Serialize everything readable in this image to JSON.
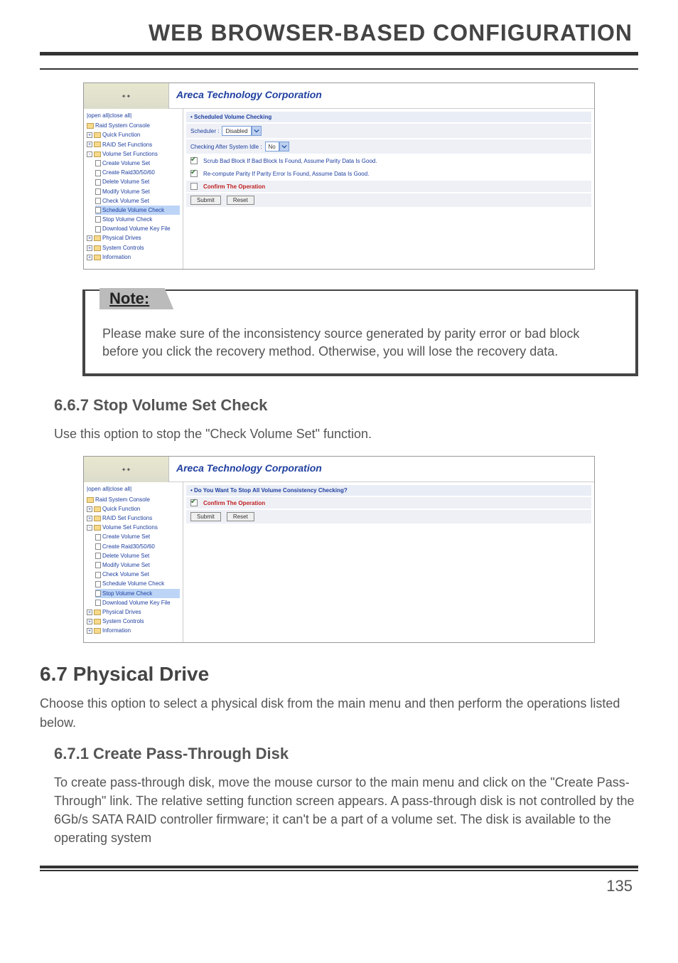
{
  "header": {
    "title": "WEB BROWSER-BASED CONFIGURATION"
  },
  "screenshot1": {
    "brand": "Areca Technology Corporation",
    "toggle": "|open all|close all|",
    "tree": {
      "root": "Raid System Console",
      "quick": "Quick Function",
      "raidset": "RAID Set Functions",
      "volset": "Volume Set Functions",
      "items": [
        "Create Volume Set",
        "Create Raid30/50/60",
        "Delete Volume Set",
        "Modify Volume Set",
        "Check Volume Set",
        "Schedule Volume Check",
        "Stop Volume Check",
        "Download Volume Key File"
      ],
      "phys": "Physical Drives",
      "sys": "System Controls",
      "info": "Information"
    },
    "panel": {
      "section": "• Scheduled Volume Checking",
      "scheduler_label": "Scheduler :",
      "scheduler_value": "Disabled",
      "idle_label": "Checking After System Idle :",
      "idle_value": "No",
      "opt1": "Scrub Bad Block If Bad Block Is Found, Assume Parity Data Is Good.",
      "opt2": "Re-compute Parity If Parity Error Is Found, Assume Data Is Good.",
      "confirm": "Confirm The Operation",
      "submit": "Submit",
      "reset": "Reset"
    }
  },
  "note": {
    "title": "Note:",
    "body": "Please make sure of the inconsistency source generated by parity error or bad block before you click the recovery method. Otherwise, you will lose the recovery data."
  },
  "sec667": {
    "heading": "6.6.7 Stop Volume Set Check",
    "para": "Use this option to stop the \"Check Volume Set\" function."
  },
  "screenshot2": {
    "brand": "Areca Technology Corporation",
    "toggle": "|open all|close all|",
    "tree": {
      "root": "Raid System Console",
      "quick": "Quick Function",
      "raidset": "RAID Set Functions",
      "volset": "Volume Set Functions",
      "items": [
        "Create Volume Set",
        "Create Raid30/50/60",
        "Delete Volume Set",
        "Modify Volume Set",
        "Check Volume Set",
        "Schedule Volume Check",
        "Stop Volume Check",
        "Download Volume Key File"
      ],
      "phys": "Physical Drives",
      "sys": "System Controls",
      "info": "Information"
    },
    "panel": {
      "section": "• Do You Want To Stop All Volume Consistency Checking?",
      "confirm": "Confirm The Operation",
      "submit": "Submit",
      "reset": "Reset"
    }
  },
  "sec67": {
    "heading": "6.7 Physical Drive",
    "para": "Choose this option to select a physical disk from the main menu and then perform the operations listed below."
  },
  "sec671": {
    "heading": "6.7.1 Create Pass-Through Disk",
    "para": "To create pass-through disk, move the mouse cursor to the main menu and click on the \"Create Pass-Through\" link. The relative setting function screen appears. A pass-through disk is not controlled by the 6Gb/s SATA RAID controller firmware; it can't be a part of a volume set. The disk is available to the operating system"
  },
  "footer": {
    "page": "135"
  }
}
